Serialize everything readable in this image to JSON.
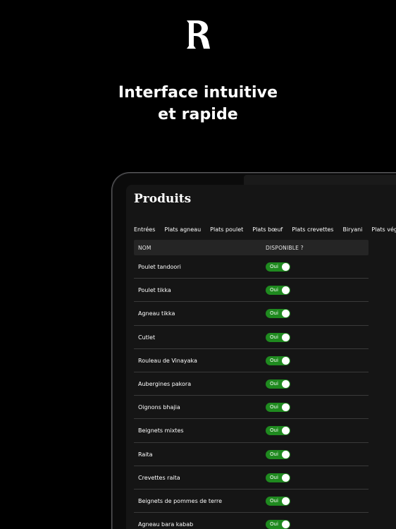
{
  "hero": {
    "headline_line1": "Interface intuitive",
    "headline_line2": "et rapide"
  },
  "screen": {
    "title": "Produits",
    "tabs": [
      "Entrées",
      "Plats agneau",
      "Plats poulet",
      "Plats bœuf",
      "Plats crevettes",
      "Biryani",
      "Plats végétariens"
    ],
    "columns": {
      "name": "NOM",
      "available": "DISPONIBLE ?"
    },
    "rows": [
      {
        "name": "Poulet tandoori",
        "available": "Oui"
      },
      {
        "name": "Poulet tikka",
        "available": "Oui"
      },
      {
        "name": "Agneau tikka",
        "available": "Oui"
      },
      {
        "name": "Cutlet",
        "available": "Oui"
      },
      {
        "name": "Rouleau de Vinayaka",
        "available": "Oui"
      },
      {
        "name": "Aubergines pakora",
        "available": "Oui"
      },
      {
        "name": "Oignons bhajia",
        "available": "Oui"
      },
      {
        "name": "Beignets mixtes",
        "available": "Oui"
      },
      {
        "name": "Raita",
        "available": "Oui"
      },
      {
        "name": "Crevettes raita",
        "available": "Oui"
      },
      {
        "name": "Beignets de pommes de terre",
        "available": "Oui"
      },
      {
        "name": "Agneau bara kabab",
        "available": "Oui"
      }
    ]
  },
  "colors": {
    "background": "#000000",
    "panel": "#151515",
    "toggle_on": "#1f8a1f",
    "text": "#ffffff"
  },
  "icons": {
    "logo": "brand-logo-r"
  }
}
